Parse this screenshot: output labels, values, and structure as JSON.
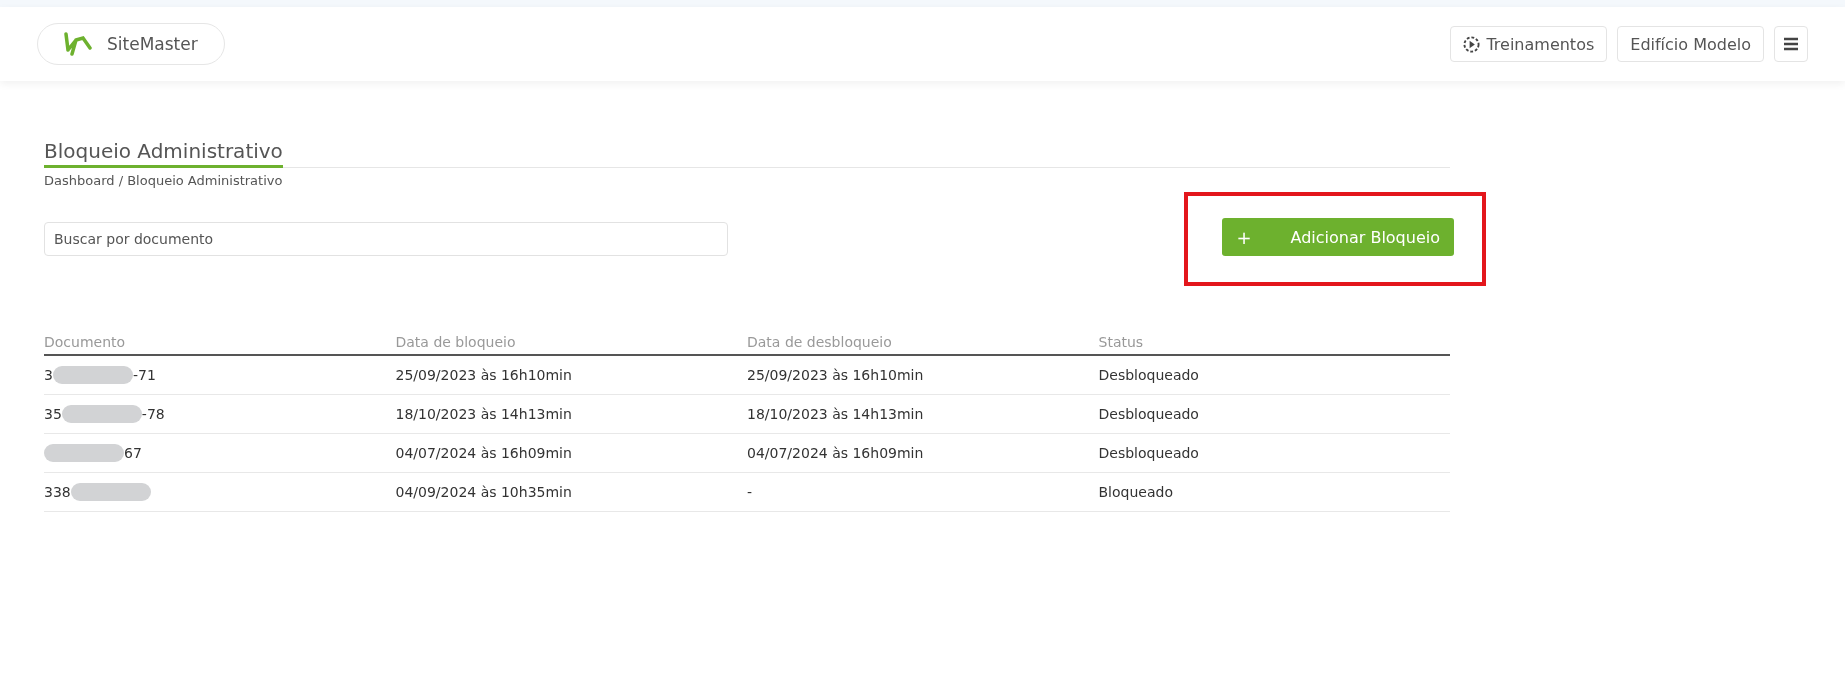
{
  "header": {
    "brand": "SiteMaster",
    "buttons": [
      {
        "kind": "training",
        "label": "Treinamentos"
      },
      {
        "kind": "plain",
        "label": "Edifício Modelo"
      },
      {
        "kind": "menu"
      }
    ]
  },
  "page": {
    "title": "Bloqueio Administrativo",
    "breadcrumb": "Dashboard / Bloqueio Administrativo"
  },
  "search": {
    "placeholder": "Buscar por documento"
  },
  "add_button": {
    "icon": "+",
    "label": "Adicionar Bloqueio"
  },
  "table": {
    "columns": [
      "Documento",
      "Data de bloqueio",
      "Data de desbloqueio",
      "Status"
    ],
    "rows": [
      {
        "document": {
          "start": "3",
          "end": "-71"
        },
        "blocked_at": "25/09/2023 às 16h10min",
        "unblocked_at": "25/09/2023 às 16h10min",
        "status": "Desbloqueado"
      },
      {
        "document": {
          "start": "35",
          "end": "-78"
        },
        "blocked_at": "18/10/2023 às 14h13min",
        "unblocked_at": "18/10/2023 às 14h13min",
        "status": "Desbloqueado"
      },
      {
        "document": {
          "end": "67"
        },
        "blocked_at": "04/07/2024 às 16h09min",
        "unblocked_at": "04/07/2024 às 16h09min",
        "status": "Desbloqueado"
      },
      {
        "document": {
          "start": "338"
        },
        "blocked_at": "04/09/2024 às 10h35min",
        "unblocked_at": "-",
        "status": "Bloqueado"
      }
    ]
  }
}
